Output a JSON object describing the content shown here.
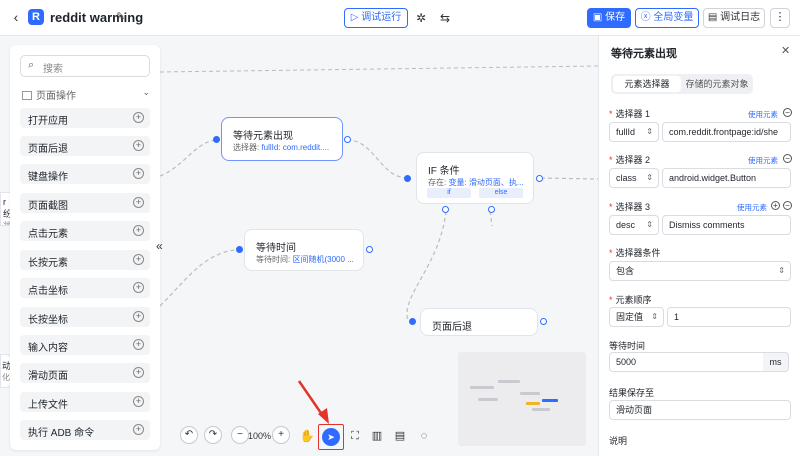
{
  "header": {
    "logo_letter": "R",
    "title": "reddit warming",
    "run_label": "▷ 调试运行",
    "save_label": "保存",
    "globals_label": "全局变量",
    "log_label": "调试日志"
  },
  "sidebar": {
    "search_placeholder": "搜索",
    "category": "页面操作",
    "items": [
      {
        "label": "打开应用"
      },
      {
        "label": "页面后退"
      },
      {
        "label": "键盘操作"
      },
      {
        "label": "页面截图"
      },
      {
        "label": "点击元素"
      },
      {
        "label": "长按元素"
      },
      {
        "label": "点击坐标"
      },
      {
        "label": "长按坐标"
      },
      {
        "label": "输入内容"
      },
      {
        "label": "滑动页面"
      },
      {
        "label": "上传文件"
      },
      {
        "label": "执行 ADB 命令"
      }
    ]
  },
  "canvas": {
    "peek_texts": [
      "r 纷",
      "状态",
      "动",
      "化"
    ],
    "nodes": {
      "wait_element": {
        "title": "等待元素出现",
        "sub_label": "选择器: ",
        "sub_value": "fullId: com.reddit...."
      },
      "if_cond": {
        "title": "IF 条件",
        "sub_label": "存在: ",
        "sub_value": "变量: 滑动页面、执...",
        "branch_if": "if",
        "branch_else": "else"
      },
      "wait_time": {
        "title": "等待时间",
        "sub_label": "等待时间: ",
        "sub_value": "区间随机(3000 ..."
      },
      "page_back": {
        "title": "页面后退"
      }
    },
    "zoom": "100%"
  },
  "panel": {
    "title": "等待元素出现",
    "tabs": [
      "元素选择器",
      "存储的元素对象"
    ],
    "selector1": {
      "label": "选择器 1",
      "link": "使用元素",
      "type": "fullId",
      "value": "com.reddit.frontpage:id/she"
    },
    "selector2": {
      "label": "选择器 2",
      "link": "使用元素",
      "type": "class",
      "value": "android.widget.Button"
    },
    "selector3": {
      "label": "选择器 3",
      "link": "使用元素",
      "type": "desc",
      "value": "Dismiss comments"
    },
    "condition": {
      "label": "选择器条件",
      "value": "包含"
    },
    "order": {
      "label": "元素顺序",
      "type": "固定值",
      "value": "1"
    },
    "wait": {
      "label": "等待时间",
      "value": "5000",
      "unit": "ms"
    },
    "save_to": {
      "label": "结果保存至",
      "value": "滑动页面"
    },
    "desc": {
      "label": "说明"
    }
  },
  "colors": {
    "accent": "#2f6bff",
    "highlight": "#e2342b"
  }
}
